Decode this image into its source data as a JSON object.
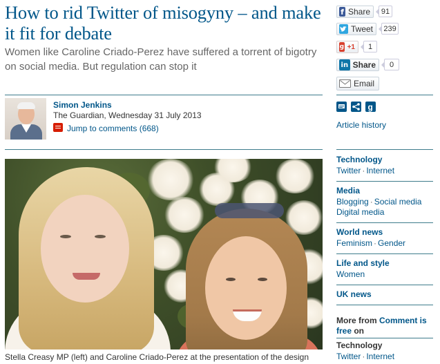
{
  "article": {
    "headline": "How to rid Twitter of misogyny – and make it fit for debate",
    "standfirst": "Women like Caroline Criado-Perez have suffered a torrent of bigotry on social media. But regulation can stop it",
    "author": "Simon Jenkins",
    "publication_date": "The Guardian, Wednesday 31 July 2013",
    "comments_link": "Jump to comments (668)",
    "caption": "Stella Creasy MP (left) and Caroline Criado-Perez at the presentation of the design"
  },
  "share": {
    "facebook": {
      "label": "Share",
      "count": "91",
      "icon": "facebook-icon",
      "color": "#3b5998"
    },
    "twitter": {
      "label": "Tweet",
      "count": "239",
      "icon": "twitter-icon",
      "color": "#2fa6e0"
    },
    "google": {
      "label": "+1",
      "count": "1",
      "icon": "google-plus-icon",
      "color": "#d8412f"
    },
    "linkedin": {
      "label": "Share",
      "count": "0",
      "icon": "linkedin-icon",
      "color": "#0e76a8"
    },
    "email": {
      "label": "Email",
      "icon": "email-icon"
    }
  },
  "tools": {
    "icons": [
      "print-icon",
      "share-icon",
      "google-icon"
    ],
    "article_history": "Article history"
  },
  "sections": [
    {
      "heading": "Technology",
      "links": [
        "Twitter",
        "Internet"
      ]
    },
    {
      "heading": "Media",
      "links": [
        "Blogging",
        "Social media",
        "Digital media"
      ]
    },
    {
      "heading": "World news",
      "links": [
        "Feminism",
        "Gender"
      ]
    },
    {
      "heading": "Life and style",
      "links": [
        "Women"
      ]
    },
    {
      "heading": "UK news",
      "links": []
    }
  ],
  "more_from": {
    "label_prefix": "More from ",
    "label_link": "Comment is free",
    "label_suffix": " on",
    "heading": "Technology",
    "links": [
      "Twitter",
      "Internet"
    ]
  },
  "colors": {
    "link_blue": "#005689",
    "rule_teal": "#3d7b8b",
    "comment_red": "#d61d00"
  }
}
